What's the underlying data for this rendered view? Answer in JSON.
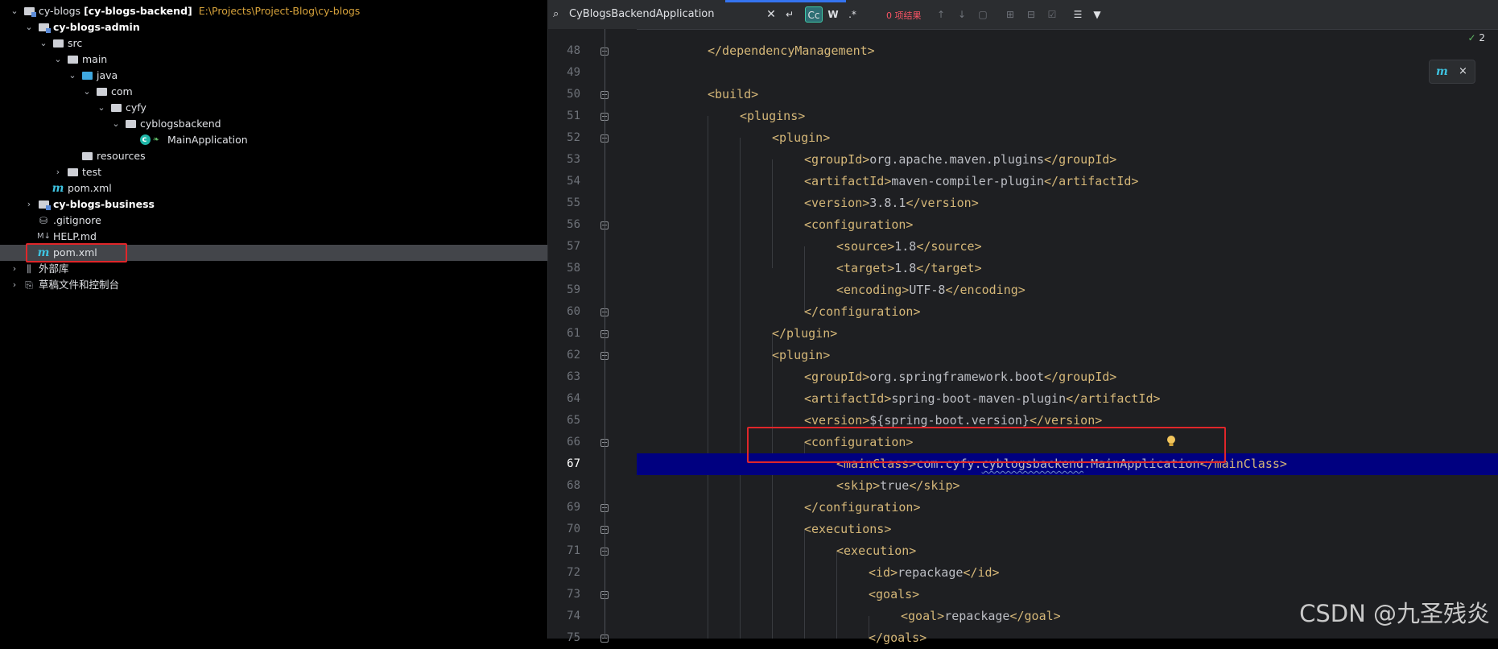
{
  "project_tree": {
    "root": {
      "name": "cy-blogs",
      "module": "[cy-blogs-backend]",
      "path": "E:\\Projects\\Project-Blog\\cy-blogs"
    },
    "admin_module": "cy-blogs-admin",
    "src": "src",
    "main": "main",
    "java": "java",
    "com": "com",
    "cyfy": "cyfy",
    "pkg": "cyblogsbackend",
    "main_class": "MainApplication",
    "resources": "resources",
    "test": "test",
    "admin_pom": "pom.xml",
    "business_module": "cy-blogs-business",
    "gitignore": ".gitignore",
    "help": "HELP.md",
    "root_pom": "pom.xml",
    "external_libs": "外部库",
    "scratches": "草稿文件和控制台"
  },
  "search": {
    "query": "CyBlogsBackendApplication",
    "case_btn": "Cc",
    "word_btn": "W",
    "regex_btn": ".*",
    "results": "0 项结果"
  },
  "editor": {
    "inspection_count": "2",
    "maven_popup_close": "×",
    "lines": [
      {
        "n": "48",
        "text": "</dependencyManagement>"
      },
      {
        "n": "49",
        "text": ""
      },
      {
        "n": "50",
        "text": "<build>"
      },
      {
        "n": "51",
        "text": "<plugins>"
      },
      {
        "n": "52",
        "text": "<plugin>"
      },
      {
        "n": "53",
        "text": "<groupId>org.apache.maven.plugins</groupId>"
      },
      {
        "n": "54",
        "text": "<artifactId>maven-compiler-plugin</artifactId>"
      },
      {
        "n": "55",
        "text": "<version>3.8.1</version>"
      },
      {
        "n": "56",
        "text": "<configuration>"
      },
      {
        "n": "57",
        "text": "<source>1.8</source>"
      },
      {
        "n": "58",
        "text": "<target>1.8</target>"
      },
      {
        "n": "59",
        "text": "<encoding>UTF-8</encoding>"
      },
      {
        "n": "60",
        "text": "</configuration>"
      },
      {
        "n": "61",
        "text": "</plugin>"
      },
      {
        "n": "62",
        "text": "<plugin>"
      },
      {
        "n": "63",
        "text": "<groupId>org.springframework.boot</groupId>"
      },
      {
        "n": "64",
        "text": "<artifactId>spring-boot-maven-plugin</artifactId>"
      },
      {
        "n": "65",
        "text": "<version>${spring-boot.version}</version>"
      },
      {
        "n": "66",
        "text": "<configuration>"
      },
      {
        "n": "67",
        "text": "<mainClass>com.cyfy.cyblogsbackend.MainApplication</mainClass>"
      },
      {
        "n": "68",
        "text": "<skip>true</skip>"
      },
      {
        "n": "69",
        "text": "</configuration>"
      },
      {
        "n": "70",
        "text": "<executions>"
      },
      {
        "n": "71",
        "text": "<execution>"
      },
      {
        "n": "72",
        "text": "<id>repackage</id>"
      },
      {
        "n": "73",
        "text": "<goals>"
      },
      {
        "n": "74",
        "text": "<goal>repackage</goal>"
      },
      {
        "n": "75",
        "text": "</goals>"
      }
    ]
  },
  "watermark": "CSDN @九圣残炎",
  "colors": {
    "tag": "#d5b778",
    "text": "#bcbec4",
    "highlight": "#000080",
    "annotation": "#e0262a",
    "selection": "#43454a"
  }
}
